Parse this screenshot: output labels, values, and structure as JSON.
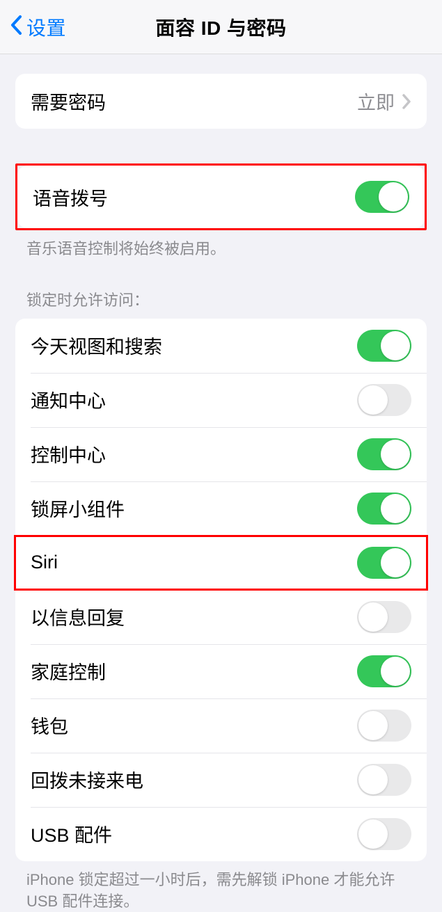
{
  "header": {
    "back_label": "设置",
    "title": "面容 ID 与密码"
  },
  "require_passcode": {
    "label": "需要密码",
    "value": "立即"
  },
  "voice_dial": {
    "label": "语音拨号",
    "footer": "音乐语音控制将始终被启用。",
    "enabled": true
  },
  "lock_access": {
    "header": "锁定时允许访问：",
    "items": [
      {
        "label": "今天视图和搜索",
        "enabled": true
      },
      {
        "label": "通知中心",
        "enabled": false
      },
      {
        "label": "控制中心",
        "enabled": true
      },
      {
        "label": "锁屏小组件",
        "enabled": true
      },
      {
        "label": "Siri",
        "enabled": true
      },
      {
        "label": "以信息回复",
        "enabled": false
      },
      {
        "label": "家庭控制",
        "enabled": true
      },
      {
        "label": "钱包",
        "enabled": false
      },
      {
        "label": "回拨未接来电",
        "enabled": false
      },
      {
        "label": "USB 配件",
        "enabled": false
      }
    ],
    "footer": "iPhone 锁定超过一小时后，需先解锁 iPhone 才能允许 USB 配件连接。"
  }
}
